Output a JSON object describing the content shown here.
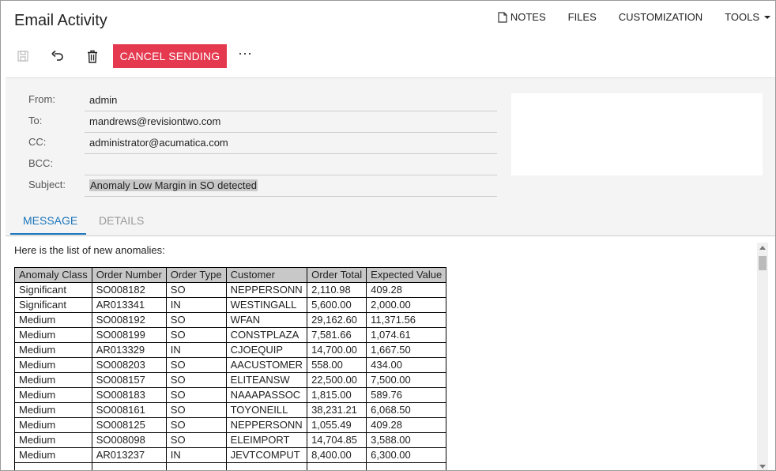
{
  "header": {
    "title": "Email Activity",
    "links": {
      "notes": "NOTES",
      "files": "FILES",
      "customization": "CUSTOMIZATION",
      "tools": "TOOLS"
    }
  },
  "toolbar": {
    "save_icon": "save-icon",
    "undo_icon": "undo-icon",
    "delete_icon": "trash-icon",
    "cancel_sending": "CANCEL SENDING",
    "more": "⋯",
    "accent_color": "#e4394f"
  },
  "form": {
    "from_label": "From:",
    "from_value": "admin",
    "to_label": "To:",
    "to_value": "mandrews@revisiontwo.com",
    "cc_label": "CC:",
    "cc_value": "administrator@acumatica.com",
    "bcc_label": "BCC:",
    "bcc_value": "",
    "subject_label": "Subject:",
    "subject_value": "Anomaly Low Margin in SO detected"
  },
  "tabs": {
    "message": "MESSAGE",
    "details": "DETAILS",
    "active_color": "#1b75bb"
  },
  "message": {
    "intro": "Here is the list of new anomalies:",
    "columns": [
      "Anomaly Class",
      "Order Number",
      "Order Type",
      "Customer",
      "Order Total",
      "Expected Value"
    ],
    "rows": [
      [
        "Significant",
        "SO008182",
        "SO",
        "NEPPERSONN",
        "2,110.98",
        "409.28"
      ],
      [
        "Significant",
        "AR013341",
        "IN",
        "WESTINGALL",
        "5,600.00",
        "2,000.00"
      ],
      [
        "Medium",
        "SO008192",
        "SO",
        "WFAN",
        "29,162.60",
        "11,371.56"
      ],
      [
        "Medium",
        "SO008199",
        "SO",
        "CONSTPLAZA",
        "7,581.66",
        "1,074.61"
      ],
      [
        "Medium",
        "AR013329",
        "IN",
        "CJOEQUIP",
        "14,700.00",
        "1,667.50"
      ],
      [
        "Medium",
        "SO008203",
        "SO",
        "AACUSTOMER",
        "558.00",
        "434.00"
      ],
      [
        "Medium",
        "SO008157",
        "SO",
        "ELITEANSW",
        "22,500.00",
        "7,500.00"
      ],
      [
        "Medium",
        "SO008183",
        "SO",
        "NAAAPASSOC",
        "1,815.00",
        "589.76"
      ],
      [
        "Medium",
        "SO008161",
        "SO",
        "TOYONEILL",
        "38,231.21",
        "6,068.50"
      ],
      [
        "Medium",
        "SO008125",
        "SO",
        "NEPPERSONN",
        "1,055.49",
        "409.28"
      ],
      [
        "Medium",
        "SO008098",
        "SO",
        "ELEIMPORT",
        "14,704.85",
        "3,588.00"
      ],
      [
        "Medium",
        "AR013237",
        "IN",
        "JEVTCOMPUT",
        "8,400.00",
        "6,300.00"
      ],
      [
        "",
        "",
        "",
        "",
        "",
        ""
      ]
    ]
  }
}
